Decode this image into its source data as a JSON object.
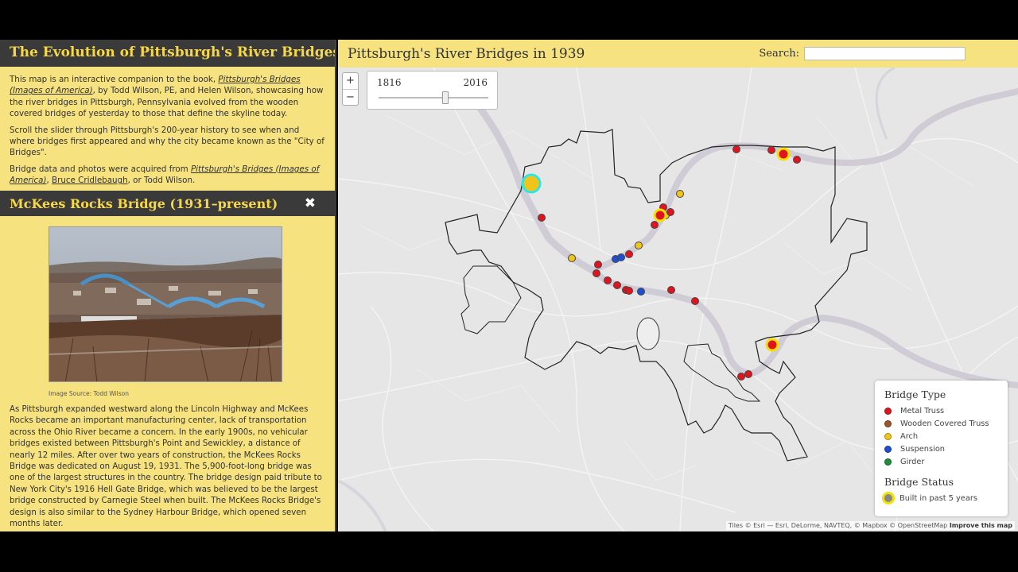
{
  "sidebar": {
    "title": "The Evolution of Pittsburgh's River Bridges",
    "intro": {
      "p1_pre": "This map is an interactive companion to the book, ",
      "p1_link": "Pittsburgh's Bridges (Images of America)",
      "p1_post": ", by Todd Wilson, PE, and Helen Wilson, showcasing how the river bridges in Pittsburgh, Pennsylvania evolved from the wooden covered bridges of yesterday to those that define the skyline today.",
      "p2": "Scroll the slider through Pittsburgh's 200-year history to see when and where bridges first appeared and why the city became known as the \"City of Bridges\".",
      "p3_pre": "Bridge data and photos were acquired from ",
      "p3_link1": "Pittsburgh's Bridges (Images of America)",
      "p3_sep": ", ",
      "p3_link2": "Bruce Cridlebaugh",
      "p3_post": ", or Todd Wilson."
    }
  },
  "detail": {
    "title": "McKees Rocks Bridge (1931–present)",
    "close_icon": "✖",
    "image_source": "Image Source: Todd Wilson",
    "body": "As Pittsburgh expanded westward along the Lincoln Highway and McKees Rocks became an important manufacturing center, lack of transportation across the Ohio River became a concern. In the early 1900s, no vehicular bridges existed between Pittsburgh's Point and Sewickley, a distance of nearly 12 miles. After over two years of construction, the McKees Rocks Bridge was dedicated on August 19, 1931. The 5,900-foot-long bridge was one of the largest structures in the country. The bridge design paid tribute to New York City's 1916 Hell Gate Bridge, which was believed to be the largest bridge constructed by Carnegie Steel when built. The McKees Rocks Bridge's design is also similar to the Sydney Harbour Bridge, which opened seven months later."
  },
  "map": {
    "title": "Pittsburgh's River Bridges in 1939",
    "search_label": "Search:",
    "search_value": "",
    "zoom_in": "+",
    "zoom_out": "−",
    "slider": {
      "min": "1816",
      "max": "2016",
      "value_year": 1939
    },
    "legend": {
      "type_title": "Bridge Type",
      "types": [
        {
          "label": "Metal Truss",
          "color": "#e0141e"
        },
        {
          "label": "Wooden Covered Truss",
          "color": "#a0522d"
        },
        {
          "label": "Arch",
          "color": "#f0c419"
        },
        {
          "label": "Suspension",
          "color": "#1f4fd1"
        },
        {
          "label": "Girder",
          "color": "#1e8c3a"
        }
      ],
      "status_title": "Bridge Status",
      "status_label": "Built in past 5 years"
    },
    "attribution_text": "Tiles © Esri — Esri, DeLorme, NAVTEQ, © Mapbox © OpenStreetMap ",
    "attribution_link": "Improve this map"
  }
}
